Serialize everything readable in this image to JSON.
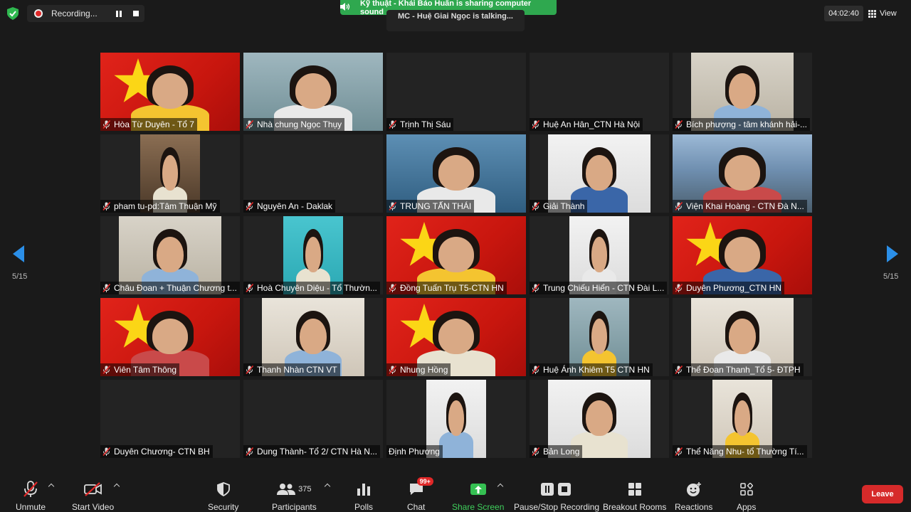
{
  "recording": {
    "label": "Recording..."
  },
  "share_banner": {
    "text": "Kỹ thuật - Khải Bảo Huấn is sharing computer sound"
  },
  "talking": {
    "text": "MC - Huệ Giai Ngọc is talking..."
  },
  "timer": {
    "value": "04:02:40"
  },
  "view": {
    "label": "View"
  },
  "pagination": {
    "left": "5/15",
    "right": "5/15"
  },
  "participants_grid": [
    {
      "name": "Hòa Từ Duyên - Tổ 7",
      "video": "flag",
      "layout": "full",
      "muted": true
    },
    {
      "name": "Nhà chung Ngọc Thụy",
      "video": "group",
      "layout": "full",
      "muted": true
    },
    {
      "name": "Trịnh Thị Sáu",
      "video": "off",
      "layout": "full",
      "muted": true
    },
    {
      "name": "Huệ An Hân_CTN Hà Nội",
      "video": "off",
      "layout": "full",
      "muted": true
    },
    {
      "name": "Bích phượng - tâm khánh hải-...",
      "video": "room",
      "layout": "mid",
      "muted": true
    },
    {
      "name": "pham tu-pd:Tâm Thuận Mỹ",
      "video": "warm",
      "layout": "mid-narrow",
      "muted": true
    },
    {
      "name": "Nguyên An - Daklak",
      "video": "off",
      "layout": "full",
      "muted": true
    },
    {
      "name": "TRUNG TẤN THÁI",
      "video": "poster",
      "layout": "full",
      "muted": true
    },
    {
      "name": "Giải Thành",
      "video": "white",
      "layout": "mid",
      "muted": true
    },
    {
      "name": "Viện Khai Hoàng - CTN Đà N...",
      "video": "city",
      "layout": "full",
      "muted": true
    },
    {
      "name": "Châu Đoan + Thuận Chương t...",
      "video": "room",
      "layout": "mid",
      "muted": true
    },
    {
      "name": "Hoà Chuyên Diệu - Tổ Thườn...",
      "video": "teal",
      "layout": "mid-narrow",
      "muted": true
    },
    {
      "name": "Đồng Tuấn Trụ T5-CTN HN",
      "video": "flag",
      "layout": "full",
      "muted": true
    },
    {
      "name": "Trung Chiếu Hiển - CTN Đài L...",
      "video": "white",
      "layout": "mid-narrow",
      "muted": true
    },
    {
      "name": "Duyên Phương_CTN HN",
      "video": "flag",
      "layout": "full",
      "muted": true
    },
    {
      "name": "Viên Tâm Thông",
      "video": "flag",
      "layout": "full",
      "muted": true
    },
    {
      "name": "Thanh Nhàn CTN VT",
      "video": "wall",
      "layout": "mid",
      "muted": true
    },
    {
      "name": "Nhung Hồng",
      "video": "flag",
      "layout": "full",
      "muted": true
    },
    {
      "name": "Huệ Ánh Khiêm T5 CTN HN",
      "video": "group",
      "layout": "mid-narrow",
      "muted": true
    },
    {
      "name": "Thể Đoan Thanh_Tổ 5- ĐTPH",
      "video": "wall",
      "layout": "mid",
      "muted": true
    },
    {
      "name": "Duyên Chương- CTN BH",
      "video": "off",
      "layout": "full",
      "muted": true
    },
    {
      "name": "Dung Thành- Tổ 2/ CTN Hà N...",
      "video": "off",
      "layout": "full",
      "muted": true
    },
    {
      "name": "Định Phương",
      "video": "white",
      "layout": "mid-narrow",
      "muted": false
    },
    {
      "name": "Bản Long",
      "video": "white",
      "layout": "mid",
      "muted": true
    },
    {
      "name": "Thể Năng Nhu- tổ Thường Tí...",
      "video": "wall",
      "layout": "mid-narrow",
      "muted": true
    }
  ],
  "toolbar": {
    "unmute": "Unmute",
    "start_video": "Start Video",
    "security": "Security",
    "participants": "Participants",
    "participants_count": "375",
    "polls": "Polls",
    "chat": "Chat",
    "chat_badge": "99+",
    "share_screen": "Share Screen",
    "pause_stop": "Pause/Stop Recording",
    "breakout": "Breakout Rooms",
    "reactions": "Reactions",
    "apps": "Apps",
    "leave": "Leave"
  },
  "colors": {
    "accent_blue": "#2b8fe8",
    "share_green": "#35c052",
    "leave_red": "#d62a2a",
    "record_red": "#e02828"
  }
}
